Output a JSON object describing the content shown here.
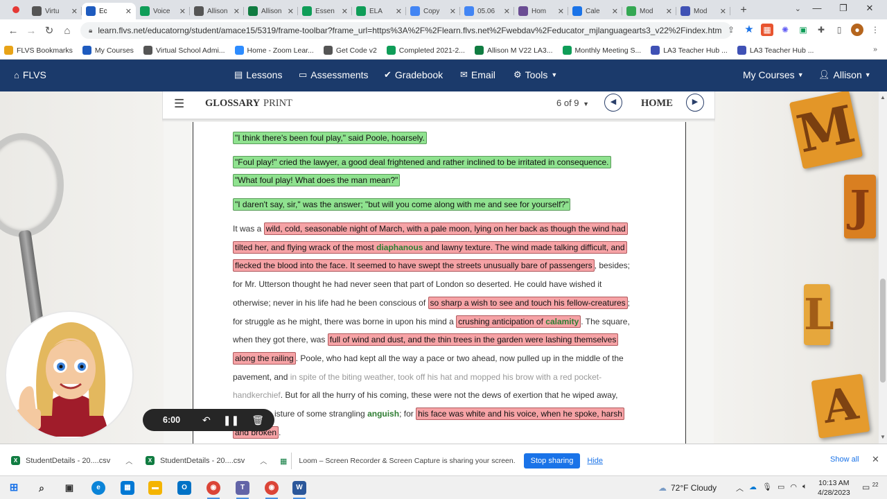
{
  "browser": {
    "tabs": [
      {
        "label": "Virtu",
        "color": "#555555"
      },
      {
        "label": "Ec",
        "color": "#1e5bbf",
        "active": true
      },
      {
        "label": "Voice",
        "color": "#0f9d58"
      },
      {
        "label": "Allison",
        "color": "#555555"
      },
      {
        "label": "Allison",
        "color": "#107c41"
      },
      {
        "label": "Essen",
        "color": "#0f9d58"
      },
      {
        "label": "ELA",
        "color": "#0f9d58"
      },
      {
        "label": "Copy",
        "color": "#4285f4"
      },
      {
        "label": "05.06",
        "color": "#4285f4"
      },
      {
        "label": "Hom",
        "color": "#6a4c93"
      },
      {
        "label": "Cale",
        "color": "#1a73e8"
      },
      {
        "label": "Mod",
        "color": "#34a853"
      },
      {
        "label": "Mod",
        "color": "#3f51b5"
      }
    ],
    "url": "learn.flvs.net/educatorng/student/amace15/5319/frame-toolbar?frame_url=https%3A%2F%2Flearn.flvs.net%2Fwebdav%2Feducator_mjlanguagearts3_v22%2Findex.htm",
    "bookmarks": [
      {
        "label": "FLVS Bookmarks",
        "color": "#e8a317"
      },
      {
        "label": "My Courses",
        "color": "#1e5bbf"
      },
      {
        "label": "Virtual School Admi...",
        "color": "#555555"
      },
      {
        "label": "Home - Zoom Lear...",
        "color": "#2d8cff"
      },
      {
        "label": "Get Code v2",
        "color": "#555555"
      },
      {
        "label": "Completed 2021-2...",
        "color": "#0f9d58"
      },
      {
        "label": "Allison M V22 LA3...",
        "color": "#107c41"
      },
      {
        "label": "Monthly Meeting S...",
        "color": "#0f9d58"
      },
      {
        "label": "LA3 Teacher Hub ...",
        "color": "#3f51b5"
      },
      {
        "label": "LA3 Teacher Hub ...",
        "color": "#3f51b5"
      }
    ]
  },
  "nav": {
    "logo": "FLVS",
    "lessons": "Lessons",
    "assessments": "Assessments",
    "gradebook": "Gradebook",
    "email": "Email",
    "tools": "Tools",
    "my_courses": "My Courses",
    "user": "Allison"
  },
  "lesson_toolbar": {
    "glossary": "GLOSSARY",
    "print": "PRINT",
    "page": "6 of 9",
    "home": "HOME"
  },
  "passage": {
    "l1": "\"I think there's been foul play,\" said Poole, hoarsely.",
    "l2": "\"Foul play!\" cried the lawyer, a good deal frightened and rather inclined to be irritated in consequence.",
    "l3": "\"What foul play! What does the man mean?\"",
    "l4": "\"I daren't say, sir,\" was the answer; \"but will you come along with me and see for yourself?\"",
    "l5_a": "It was a ",
    "l5_b": "wild, cold, seasonable night of March, with a pale moon, lying on her back as though the wind had",
    "l6_a": "tilted her, and flying wrack of the most ",
    "l6_vocab": "diaphanous",
    "l6_b": " and lawny texture. The wind made talking difficult, and",
    "l7_a": "flecked the blood into the face. It seemed to have swept the streets unusually bare of passengers",
    "l7_b": ", besides;",
    "l8": "for Mr. Utterson thought he had never seen that part of London so deserted. He could have wished it",
    "l9_a": "otherwise; never in his life had he been conscious of ",
    "l9_b": "so sharp a wish to see and touch his fellow-creatures",
    "l9_c": ";",
    "l10_a": "for struggle as he might, there was borne in upon his mind a ",
    "l10_b": "crushing anticipation of ",
    "l10_vocab": "calamity",
    "l10_c": ". The square,",
    "l11_a": "when they got there, was ",
    "l11_b": "full of wind and dust, and the thin trees in the garden were lashing themselves",
    "l12_a": "along the railing",
    "l12_b": ". Poole, who had kept all the way a pace or two ahead, now pulled up in the middle of the",
    "l13_a": "pavement, and ",
    "l13_b": "in spite of the biting weather, took off his hat and mopped his brow with a red pocket-",
    "l14_a": "handkerchief",
    "l14_b": ". But for all the hurry of his coming, these were not the dews of exertion that he wiped away,",
    "l15_a": "isture of some strangling ",
    "l15_vocab": "anguish",
    "l15_b": "; for ",
    "l15_c": "his face was white and his voice, when he spoke, harsh",
    "l16_a": "and broken",
    "l16_b": "."
  },
  "decor_letters": {
    "m": "M",
    "j": "J",
    "l": "L",
    "a": "A"
  },
  "loom": {
    "timer": "6:00"
  },
  "downloads": {
    "file1": "StudentDetails - 20....csv",
    "file2": "StudentDetails - 20....csv",
    "share_message": "Loom – Screen Recorder & Screen Capture is sharing your screen.",
    "stop_sharing": "Stop sharing",
    "hide": "Hide",
    "show_all": "Show all"
  },
  "taskbar": {
    "weather": "72°F  Cloudy",
    "time": "10:13 AM",
    "date": "4/28/2023",
    "notifications": "22"
  },
  "colors": {
    "nav_bg": "#1b3a6b",
    "highlight_green": "#8fe28f",
    "highlight_red": "#f6a3a6",
    "vocab": "#2e7d32"
  }
}
